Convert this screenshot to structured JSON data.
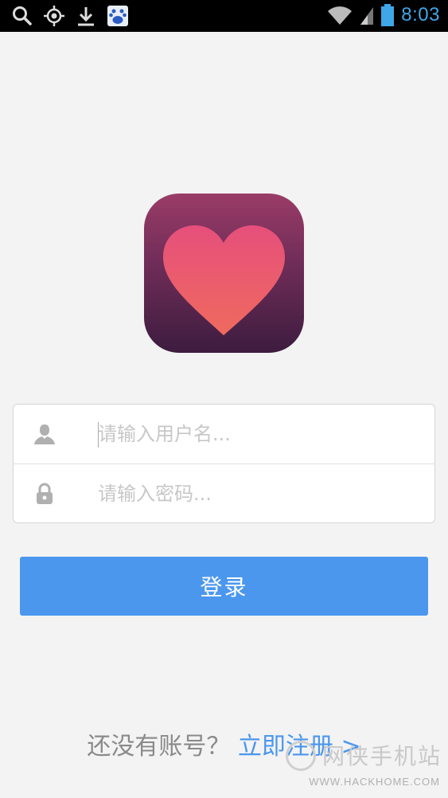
{
  "status_bar": {
    "time": "8:03",
    "icons": [
      "search-icon",
      "location-icon",
      "download-icon",
      "baidu-app-icon",
      "wifi-icon",
      "signal-icon",
      "battery-icon"
    ]
  },
  "logo": {
    "icon": "heart-icon"
  },
  "form": {
    "username_placeholder": "请输入用户名...",
    "password_placeholder": "请输入密码...",
    "username_icon": "user-icon",
    "password_icon": "lock-icon"
  },
  "login_button": {
    "label": "登录"
  },
  "footer": {
    "question": "还没有账号？",
    "register_link": "立即注册 >"
  },
  "watermark": {
    "title": "网侠手机站",
    "url": "WWW.HACKHOME.COM"
  },
  "colors": {
    "accent": "#4b97ee",
    "status_blue": "#3fa6e8",
    "logo_top": "#9a3c67",
    "logo_bottom": "#3d1c3f",
    "heart_top": "#e64f7c",
    "heart_bottom": "#ef6a5e"
  }
}
